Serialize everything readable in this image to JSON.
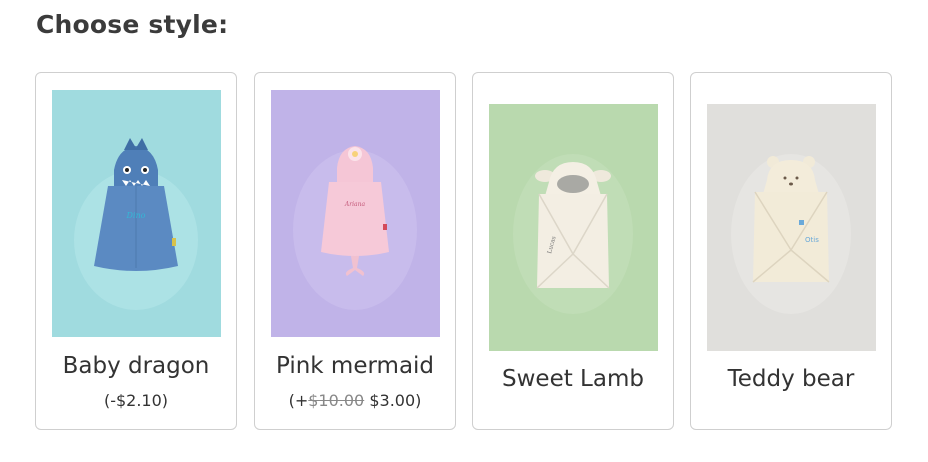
{
  "heading": "Choose style:",
  "styles": [
    {
      "name": "Baby dragon",
      "price_text": "(-$2.10)",
      "background": "#a0dbdf"
    },
    {
      "name": "Pink mermaid",
      "price_prefix": "(+",
      "price_old": "$10.00",
      "price_new": "$3.00",
      "price_suffix": ")",
      "background": "#c0b3e8"
    },
    {
      "name": "Sweet Lamb",
      "background": "#b9d9ae"
    },
    {
      "name": "Teddy bear",
      "background": "#e0dfdc"
    }
  ],
  "colors": {
    "border": "#cfcfcf",
    "text": "#333333"
  }
}
